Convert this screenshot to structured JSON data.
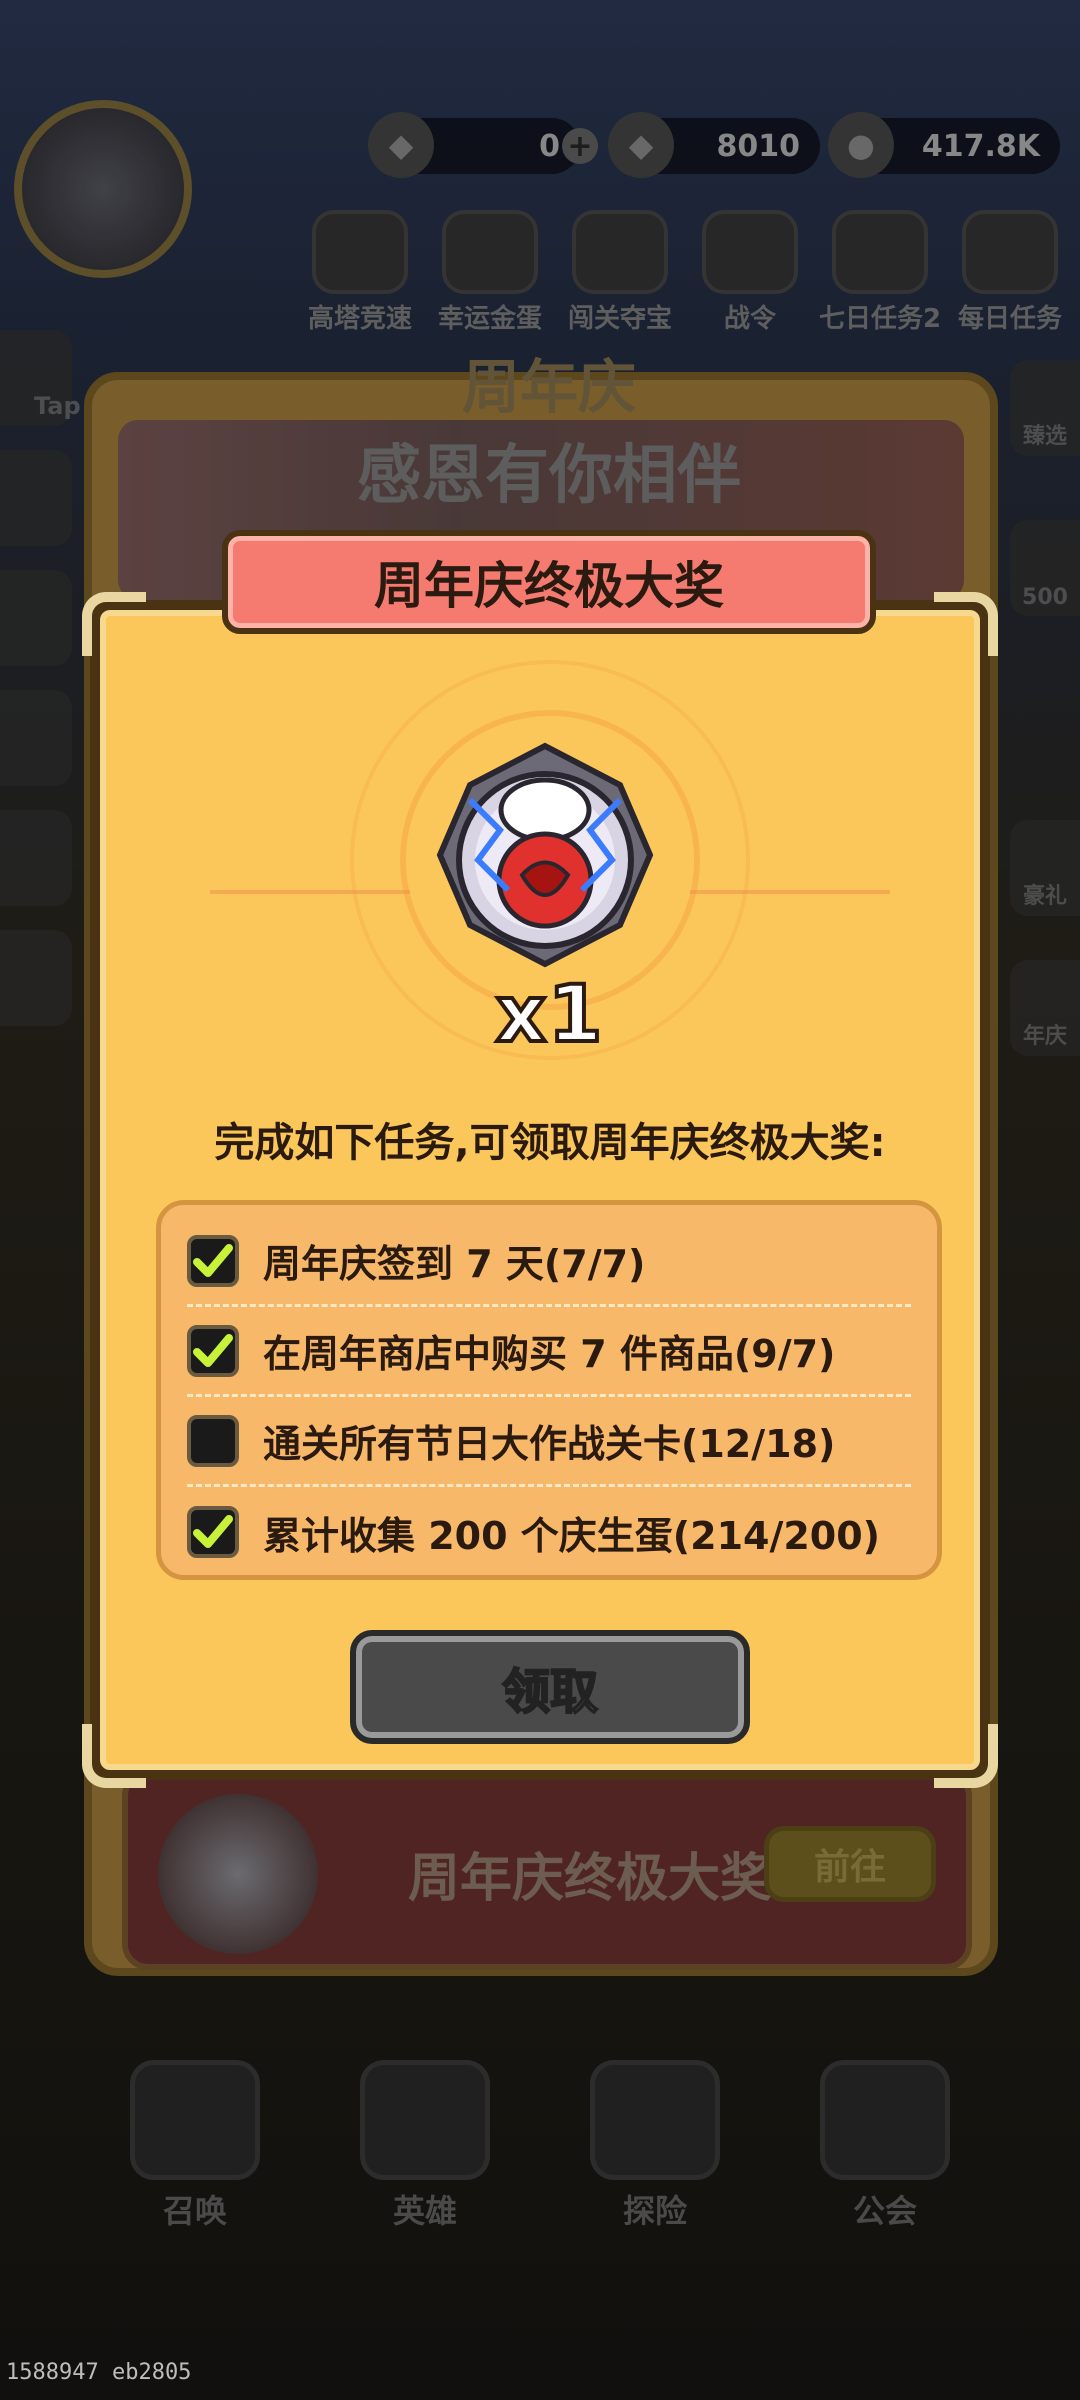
{
  "background": {
    "resources": [
      {
        "icon": "gem-icon",
        "value": "0"
      },
      {
        "icon": "crystal-icon",
        "value": "8010"
      },
      {
        "icon": "coin-icon",
        "value": "417.8K"
      }
    ],
    "top_icons": [
      {
        "label": "高塔竞速"
      },
      {
        "label": "幸运金蛋"
      },
      {
        "label": "闯关夺宝"
      },
      {
        "label": "战令"
      },
      {
        "label": "七日任务2"
      },
      {
        "label": "每日任务"
      }
    ],
    "side_left_labels": [
      "Tap"
    ],
    "side_right_labels": [
      "臻选",
      "500",
      "豪礼",
      "年庆"
    ],
    "bottom_nav": [
      {
        "label": "召唤"
      },
      {
        "label": "英雄"
      },
      {
        "label": "探险"
      },
      {
        "label": "公会"
      }
    ]
  },
  "event": {
    "title": "周年庆",
    "subtitle": "感恩有你相伴",
    "row_name": "周年庆终极大奖",
    "go_label": "前往"
  },
  "modal": {
    "title": "周年庆终极大奖",
    "reward_qty": "x1",
    "description": "完成如下任务,可领取周年庆终极大奖:",
    "tasks": [
      {
        "text": "周年庆签到 7 天(7/7)",
        "done": true
      },
      {
        "text": "在周年商店中购买 7 件商品(9/7)",
        "done": true
      },
      {
        "text": "通关所有节日大作战关卡(12/18)",
        "done": false
      },
      {
        "text": "累计收集 200 个庆生蛋(214/200)",
        "done": true
      }
    ],
    "claim_label": "领取"
  },
  "watermark": "1588947 eb2805",
  "colors": {
    "modal_bg": "#fcc75a",
    "title_bar": "#f57b70",
    "tasks_bg": "#f7b86a",
    "check": "#c8f23a",
    "claim_btn": "#4a4a4a"
  }
}
